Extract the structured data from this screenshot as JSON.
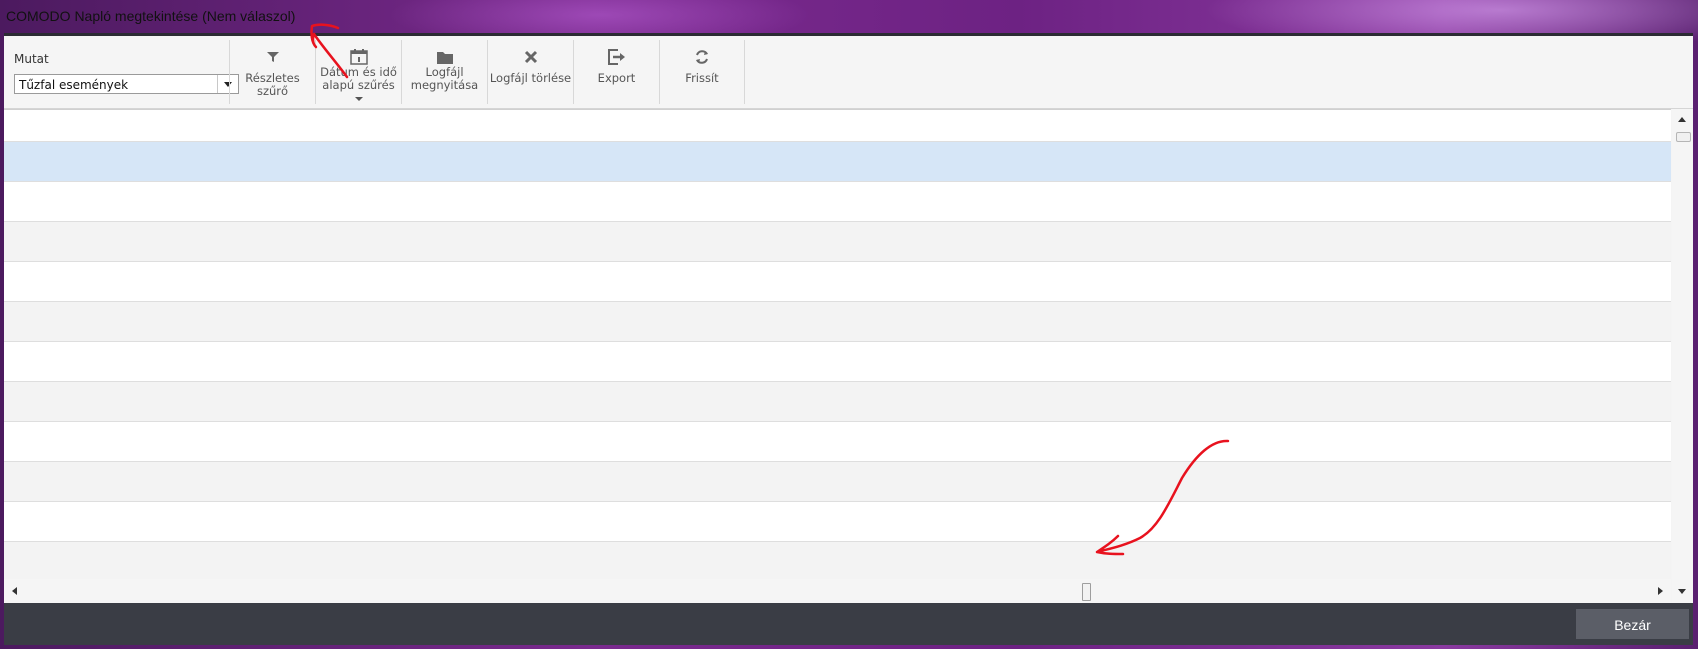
{
  "window": {
    "title": "COMODO Napló megtekintése (Nem válaszol)"
  },
  "toolbar": {
    "show_label": "Mutat",
    "show_select_value": "Tűzfal események",
    "buttons": [
      {
        "label_line1": "Részletes szűrő",
        "label_line2": "",
        "icon": "filter-icon"
      },
      {
        "label_line1": "Dátum és idő",
        "label_line2": "alapú szűrés",
        "icon": "calendar-icon"
      },
      {
        "label_line1": "Logfájl",
        "label_line2": "megnyitása",
        "icon": "folder-icon"
      },
      {
        "label_line1": "Logfájl törlése",
        "label_line2": "",
        "icon": "delete-x-icon"
      },
      {
        "label_line1": "Export",
        "label_line2": "",
        "icon": "export-icon"
      },
      {
        "label_line1": "Frissít",
        "label_line2": "",
        "icon": "refresh-icon"
      }
    ]
  },
  "grid": {
    "row_count": 12,
    "selected_row_index": 1,
    "colors": {
      "white": "#ffffff",
      "alt": "#f3f3f3",
      "selected": "#d6e6f7"
    }
  },
  "footer": {
    "close_label": "Bezár"
  },
  "colors": {
    "annotation": "#e8121e",
    "footer_bg": "#3a3d45"
  }
}
